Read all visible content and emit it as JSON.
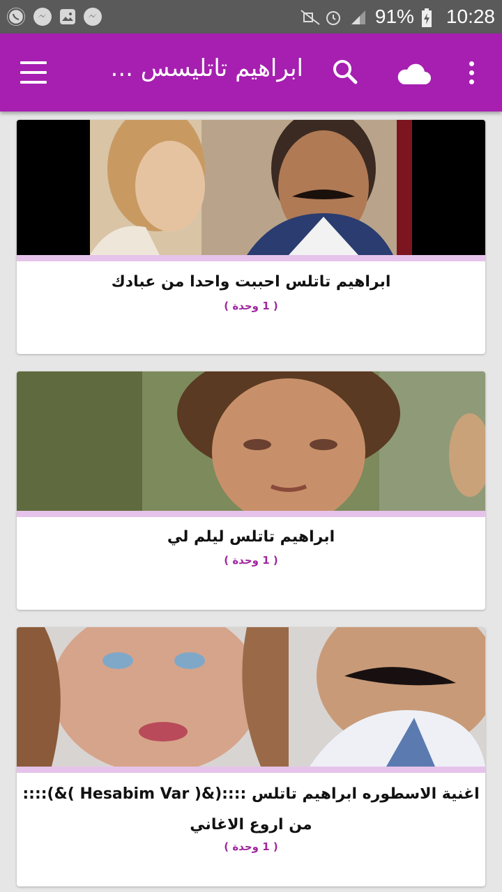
{
  "status_bar": {
    "battery": "91%",
    "time": "10:28",
    "left_icons": [
      "whatsapp-icon",
      "messenger-icon",
      "gallery-icon",
      "messenger-icon"
    ],
    "right_icons": [
      "mute-icon",
      "alarm-icon",
      "signal-icon",
      "battery-charging-icon"
    ]
  },
  "toolbar": {
    "title": "ابراهيم تاتليسس ...",
    "background": "#a61fb0",
    "icons": [
      "menu-icon",
      "search-icon",
      "cloud-icon",
      "more-vert-icon"
    ]
  },
  "items": [
    {
      "title": "ابراهيم تاتلس احببت واحدا من عبادك",
      "count": "( 1 وحدة )"
    },
    {
      "title": "ابراهيم تاتلس ليلم لي",
      "count": "( 1 وحدة )"
    },
    {
      "title": "اغنية الاسطوره ابراهيم تاتلس ::::(&( Hesabim Var )&):::: من اروع الاغاني",
      "count": "( 1 وحدة )"
    }
  ],
  "accent_strip_color": "#e6c3ea",
  "count_color": "#a0279f"
}
